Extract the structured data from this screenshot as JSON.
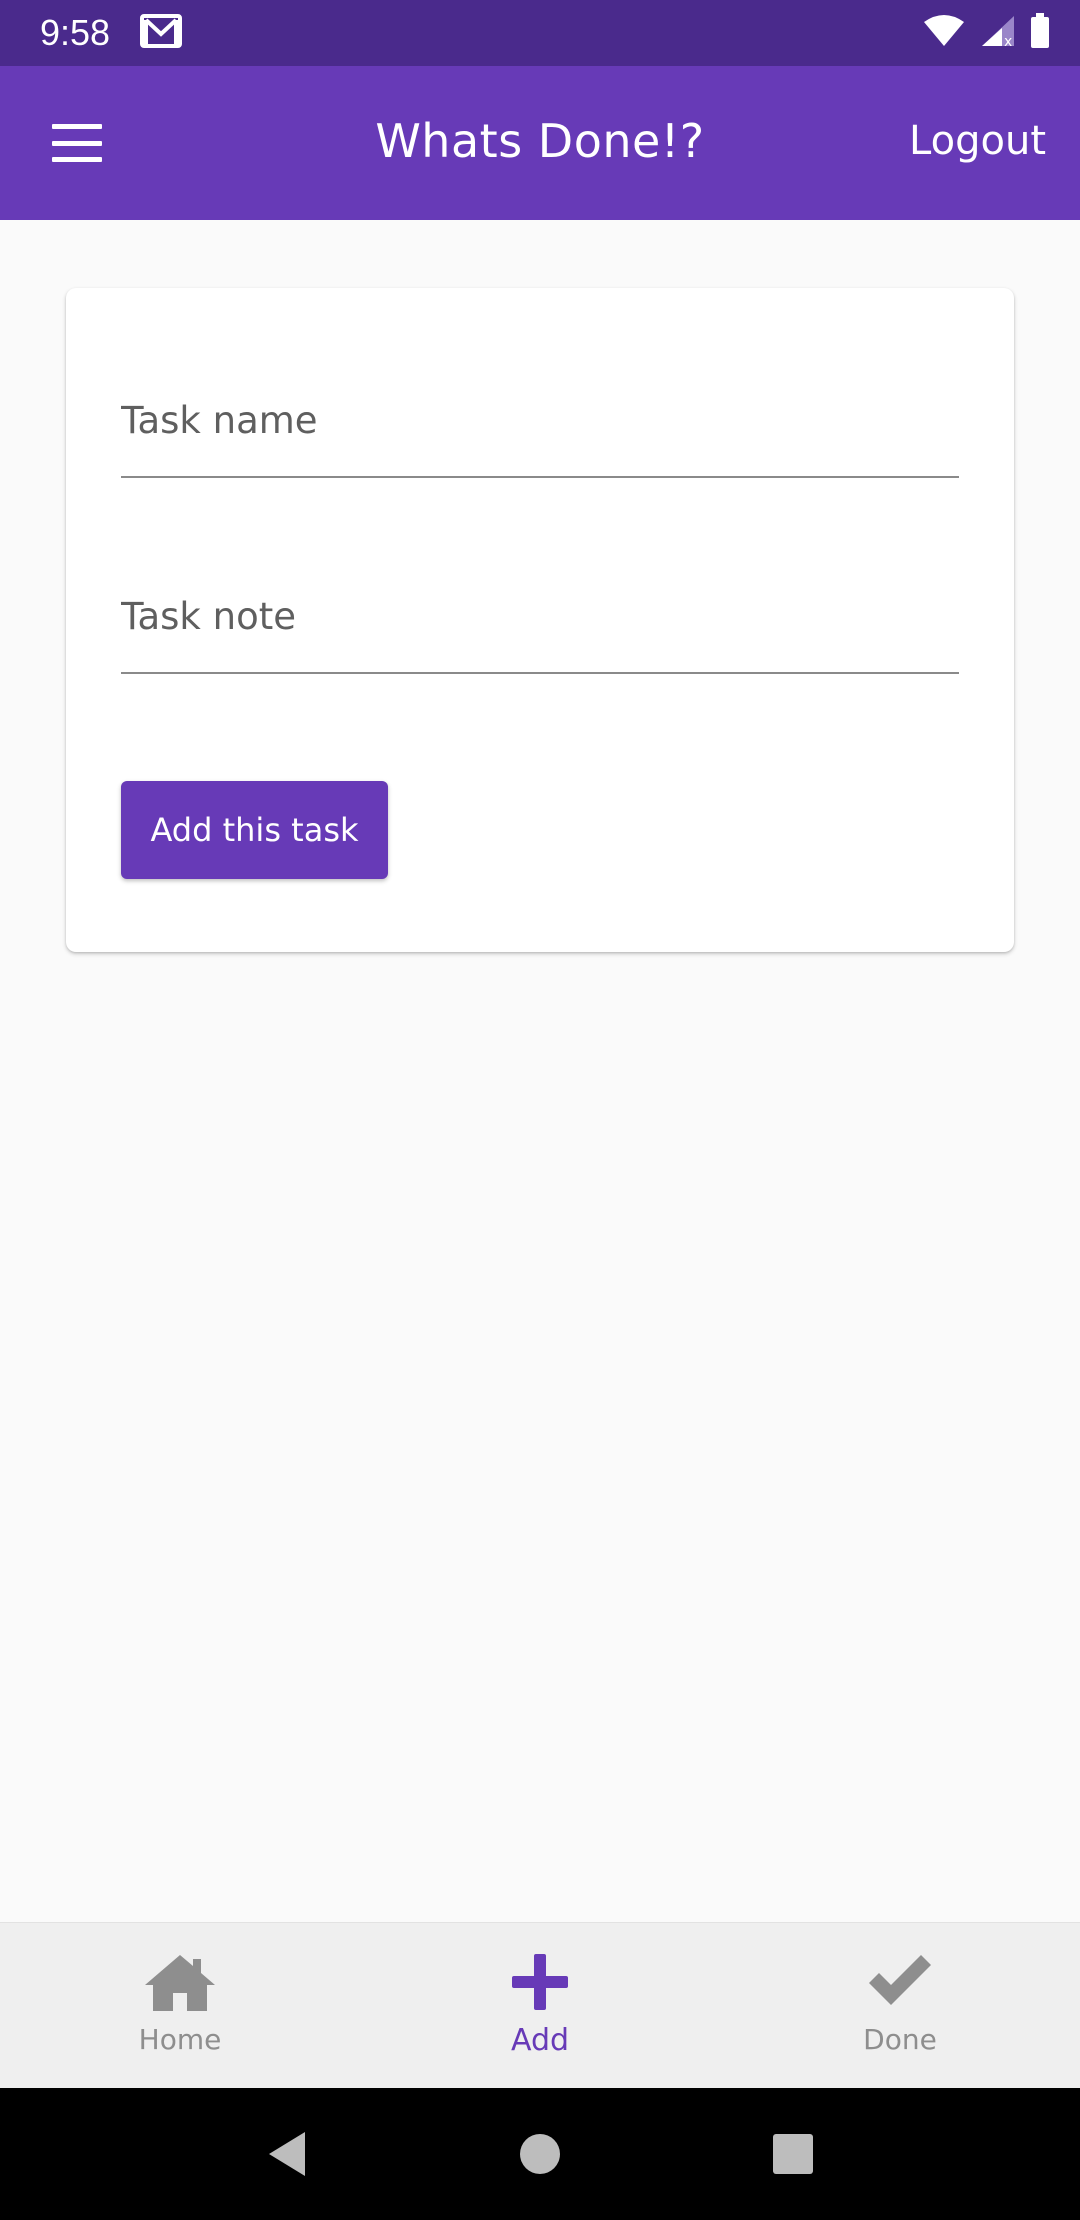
{
  "status_bar": {
    "time": "9:58",
    "icons": [
      "gmail-icon",
      "wifi-icon",
      "signal-icon",
      "battery-icon"
    ]
  },
  "app_bar": {
    "title": "Whats Done!?",
    "logout_label": "Logout",
    "menu_icon": "hamburger-menu-icon"
  },
  "form": {
    "task_name_placeholder": "Task name",
    "task_note_placeholder": "Task note",
    "submit_label": "Add this task"
  },
  "bottom_nav": {
    "items": [
      {
        "label": "Home",
        "icon": "home-icon"
      },
      {
        "label": "Add",
        "icon": "plus-icon",
        "active": true
      },
      {
        "label": "Done",
        "icon": "checkmark-icon"
      }
    ]
  },
  "colors": {
    "primary": "#673ab7",
    "status_bar": "#4a2a8c",
    "inactive_nav": "#8e8e8e"
  }
}
